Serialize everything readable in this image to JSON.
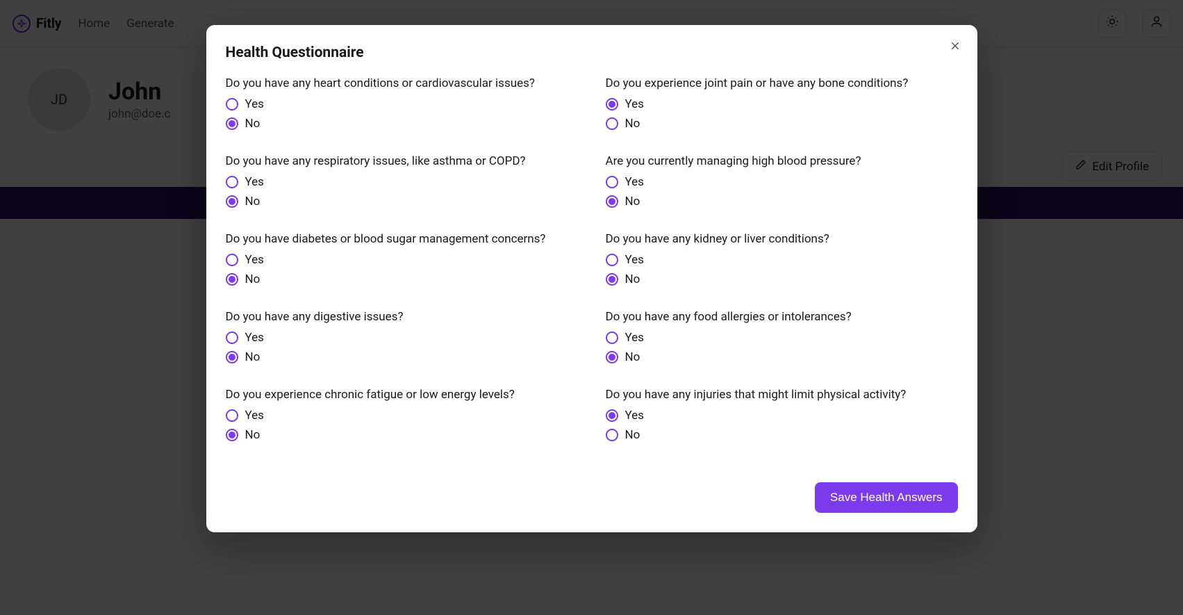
{
  "brand": "Fitly",
  "nav": {
    "home": "Home",
    "generate": "Generate"
  },
  "profile": {
    "initials": "JD",
    "name": "John",
    "email": "john@doe.c"
  },
  "editProfile": "Edit Profile",
  "modal": {
    "title": "Health Questionnaire",
    "yes": "Yes",
    "no": "No",
    "saveLabel": "Save Health Answers",
    "questions": [
      {
        "text": "Do you have any heart conditions or cardiovascular issues?",
        "answer": "no"
      },
      {
        "text": "Do you experience joint pain or have any bone conditions?",
        "answer": "yes"
      },
      {
        "text": "Do you have any respiratory issues, like asthma or COPD?",
        "answer": "no"
      },
      {
        "text": "Are you currently managing high blood pressure?",
        "answer": "no"
      },
      {
        "text": "Do you have diabetes or blood sugar management concerns?",
        "answer": "no"
      },
      {
        "text": "Do you have any kidney or liver conditions?",
        "answer": "no"
      },
      {
        "text": "Do you have any digestive issues?",
        "answer": "no"
      },
      {
        "text": "Do you have any food allergies or intolerances?",
        "answer": "no"
      },
      {
        "text": "Do you experience chronic fatigue or low energy levels?",
        "answer": "no"
      },
      {
        "text": "Do you have any injuries that might limit physical activity?",
        "answer": "yes"
      }
    ]
  }
}
